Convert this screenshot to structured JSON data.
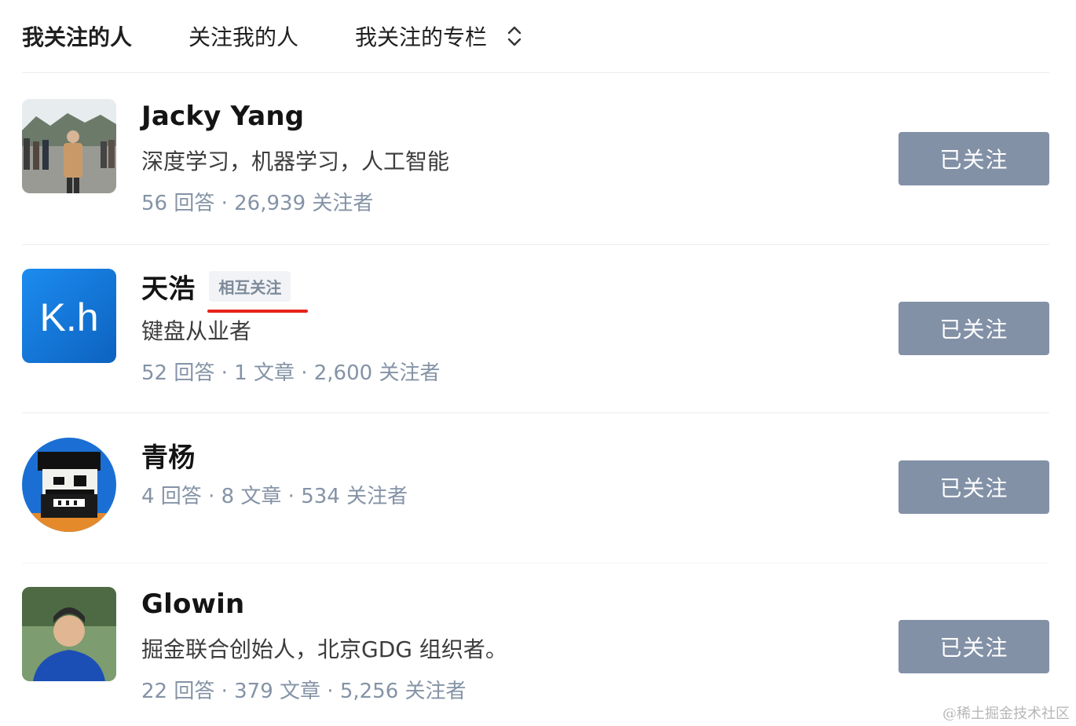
{
  "tabs": [
    {
      "label": "我关注的人",
      "active": true
    },
    {
      "label": "关注我的人",
      "active": false
    },
    {
      "label": "我关注的专栏",
      "active": false
    }
  ],
  "users": [
    {
      "name": "Jacky Yang",
      "badge": "",
      "desc": "深度学习，机器学习，人工智能",
      "stats": "56 回答 · 26,939 关注者",
      "button": "已关注",
      "avatar": "photo-avatar"
    },
    {
      "name": "天浩",
      "badge": "相互关注",
      "desc": "键盘从业者",
      "stats": "52 回答 · 1 文章 · 2,600 关注者",
      "button": "已关注",
      "avatar_text": "K.h",
      "avatar": "kh-logo-avatar"
    },
    {
      "name": "青杨",
      "badge": "",
      "desc": "",
      "stats": "4 回答 · 8 文章 · 534 关注者",
      "button": "已关注",
      "avatar": "pixel-character-avatar"
    },
    {
      "name": "Glowin",
      "badge": "",
      "desc": "掘金联合创始人，北京GDG 组织者。",
      "stats": "22 回答 · 379 文章 · 5,256 关注者",
      "button": "已关注",
      "avatar": "photo-avatar"
    }
  ],
  "watermark": "@稀土掘金技术社区",
  "colors": {
    "button_bg": "#8391a7",
    "stats_text": "#8493a6",
    "badge_bg": "#f1f3f6",
    "badge_text": "#7d8a99",
    "highlight_underline": "#e8231a",
    "kh_avatar_bg": "#1277d6"
  }
}
